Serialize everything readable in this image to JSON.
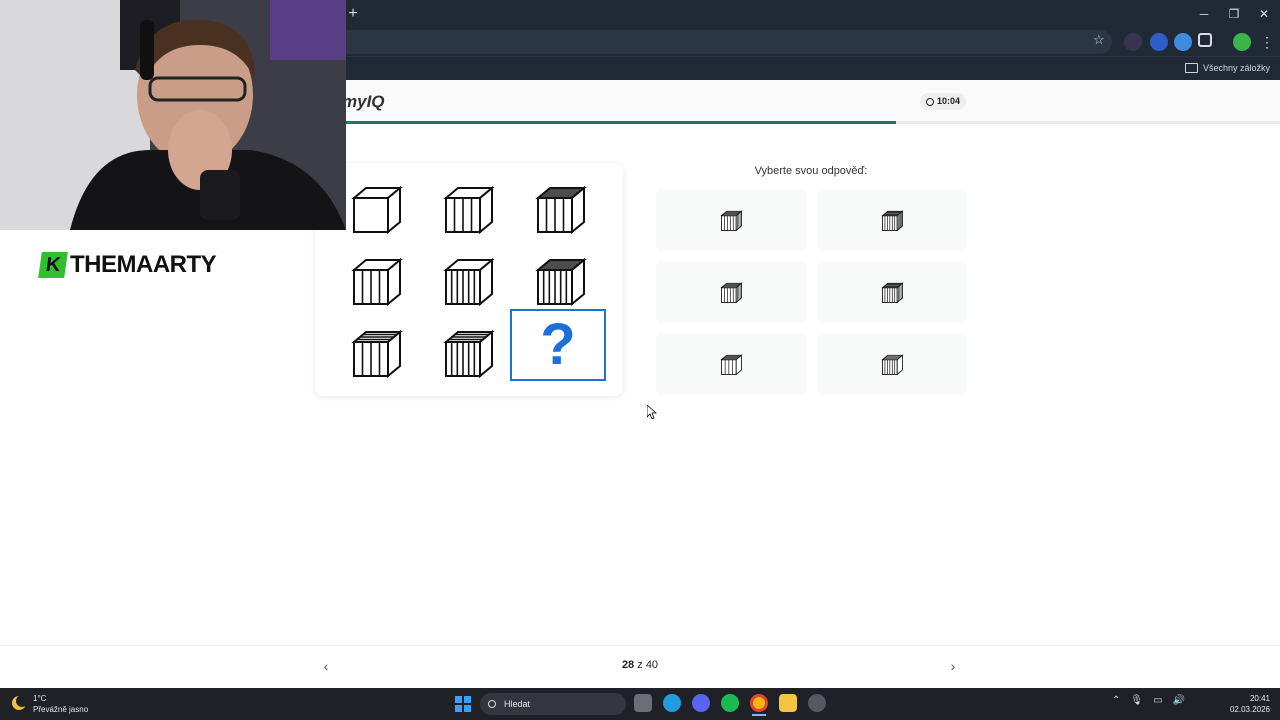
{
  "browser": {
    "new_tab_symbol": "+",
    "bookmarks_all": "Všechny záložky"
  },
  "header": {
    "logo_text": "myIQ",
    "timer": "10:04",
    "progress": 0.7
  },
  "puzzle": {
    "missing_symbol": "?"
  },
  "answers": {
    "title": "Vyberte svou odpověď:"
  },
  "footer": {
    "current": "28",
    "of": "z",
    "total": "40",
    "prev_symbol": "‹",
    "next_symbol": "›"
  },
  "overlay": {
    "streamer_name": "THEMAARTY",
    "logo_letter": "K"
  },
  "taskbar": {
    "temperature": "1°C",
    "weather": "Převážně jasno",
    "search_placeholder": "Hledat",
    "time": "20:41",
    "date": "02.03.2026"
  },
  "colors": {
    "accent": "#1e6fd8",
    "progress": "#1a7a67"
  }
}
